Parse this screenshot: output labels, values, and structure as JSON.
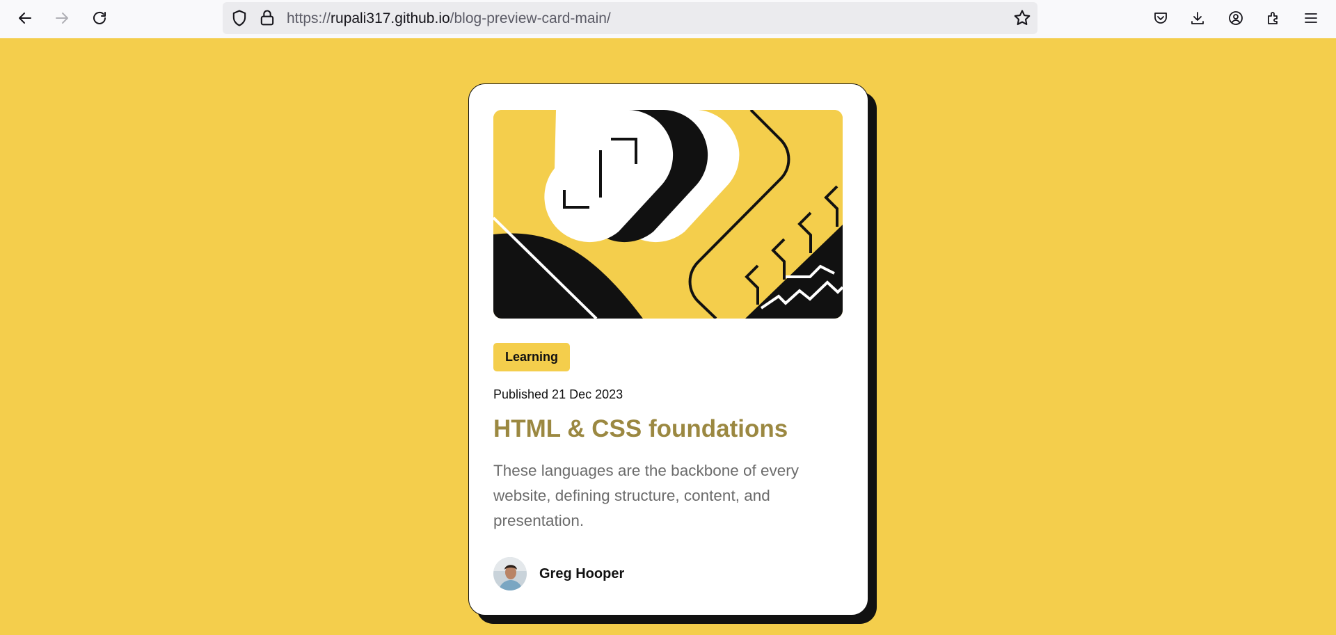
{
  "browser": {
    "url_prefix": "https://",
    "url_host": "rupali317.github.io",
    "url_path": "/blog-preview-card-main/",
    "icons": [
      "back-arrow-icon",
      "forward-arrow-icon",
      "reload-icon",
      "shield-icon",
      "lock-icon",
      "bookmark-star-icon",
      "pocket-icon",
      "downloads-icon",
      "account-icon",
      "extensions-icon",
      "menu-icon"
    ]
  },
  "card": {
    "tag": "Learning",
    "published": "Published 21 Dec 2023",
    "title": "HTML & CSS foundations",
    "description": "These languages are the backbone of every website, defining structure, content, and presentation.",
    "author": "Greg Hooper"
  },
  "colors": {
    "background": "#f4ce4c",
    "card": "#ffffff",
    "ink": "#111111",
    "title": "#9b8841",
    "body_text": "#6b6b6b"
  }
}
